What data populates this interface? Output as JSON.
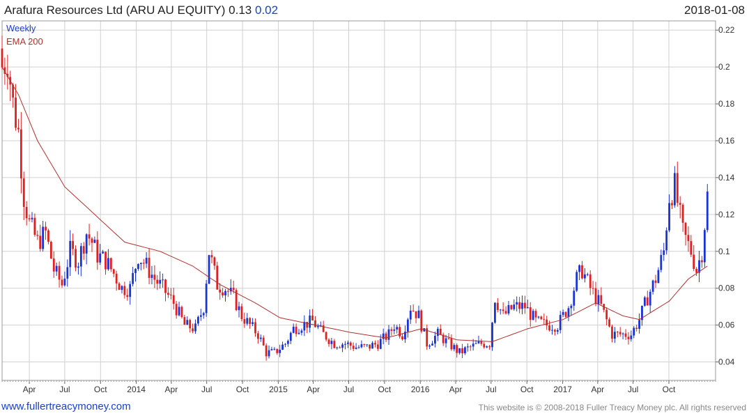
{
  "header": {
    "title": "Arafura Resources Ltd (ARU AU EQUITY) 0.13",
    "change": "0.02",
    "date": "2018-01-08"
  },
  "footer": {
    "site": "www.fullertreacymoney.com",
    "copyright": "This website is © 2008-2018 Fuller Treacy Money plc. All rights reserved"
  },
  "colors": {
    "up": "#1a33d6",
    "down": "#e02020",
    "ema": "#b03030",
    "grid": "#d0d0d0"
  },
  "chart_data": {
    "type": "candlestick",
    "legend": [
      "Weekly",
      "EMA 200"
    ],
    "ylim": [
      0.03,
      0.225
    ],
    "yticks": [
      0.04,
      0.06,
      0.08,
      0.1,
      0.12,
      0.14,
      0.16,
      0.18,
      0.2,
      0.22
    ],
    "ytick_labels": [
      "0.04",
      "0.06",
      "0.08",
      "0.1",
      "0.12",
      "0.14",
      "0.16",
      "0.18",
      "0.2",
      "0.22"
    ],
    "xlim": [
      "2013-01-21",
      "2018-01-29"
    ],
    "xticks": [
      {
        "date": "2013-04-01",
        "label": "Apr"
      },
      {
        "date": "2013-07-01",
        "label": "Jul"
      },
      {
        "date": "2013-10-01",
        "label": "Oct"
      },
      {
        "date": "2014-01-01",
        "label": "2014"
      },
      {
        "date": "2014-04-01",
        "label": "Apr"
      },
      {
        "date": "2014-07-01",
        "label": "Jul"
      },
      {
        "date": "2014-10-01",
        "label": "Oct"
      },
      {
        "date": "2015-01-01",
        "label": "2015"
      },
      {
        "date": "2015-04-01",
        "label": "Apr"
      },
      {
        "date": "2015-07-01",
        "label": "Jul"
      },
      {
        "date": "2015-10-01",
        "label": "Oct"
      },
      {
        "date": "2016-01-01",
        "label": "2016"
      },
      {
        "date": "2016-04-01",
        "label": "Apr"
      },
      {
        "date": "2016-07-01",
        "label": "Jul"
      },
      {
        "date": "2016-10-01",
        "label": "Oct"
      },
      {
        "date": "2017-01-01",
        "label": "2017"
      },
      {
        "date": "2017-04-01",
        "label": "Apr"
      },
      {
        "date": "2017-07-01",
        "label": "Jul"
      },
      {
        "date": "2017-10-01",
        "label": "Oct"
      }
    ],
    "close_anchors": [
      [
        "2013-01-21",
        0.2
      ],
      [
        "2013-02-04",
        0.205
      ],
      [
        "2013-02-18",
        0.18
      ],
      [
        "2013-03-04",
        0.165
      ],
      [
        "2013-03-18",
        0.13
      ],
      [
        "2013-04-01",
        0.115
      ],
      [
        "2013-04-22",
        0.105
      ],
      [
        "2013-05-13",
        0.11
      ],
      [
        "2013-06-03",
        0.09
      ],
      [
        "2013-06-24",
        0.082
      ],
      [
        "2013-07-15",
        0.1
      ],
      [
        "2013-08-05",
        0.095
      ],
      [
        "2013-08-26",
        0.11
      ],
      [
        "2013-09-09",
        0.105
      ],
      [
        "2013-09-23",
        0.098
      ],
      [
        "2013-10-14",
        0.095
      ],
      [
        "2013-11-04",
        0.088
      ],
      [
        "2013-11-25",
        0.08
      ],
      [
        "2013-12-16",
        0.08
      ],
      [
        "2014-01-06",
        0.098
      ],
      [
        "2014-01-27",
        0.092
      ],
      [
        "2014-02-17",
        0.085
      ],
      [
        "2014-03-10",
        0.08
      ],
      [
        "2014-04-07",
        0.072
      ],
      [
        "2014-05-05",
        0.06
      ],
      [
        "2014-06-02",
        0.058
      ],
      [
        "2014-06-23",
        0.07
      ],
      [
        "2014-07-07",
        0.1
      ],
      [
        "2014-07-28",
        0.082
      ],
      [
        "2014-08-18",
        0.08
      ],
      [
        "2014-09-08",
        0.075
      ],
      [
        "2014-09-29",
        0.065
      ],
      [
        "2014-10-20",
        0.06
      ],
      [
        "2014-11-10",
        0.055
      ],
      [
        "2014-12-01",
        0.045
      ],
      [
        "2014-12-22",
        0.045
      ],
      [
        "2015-01-19",
        0.05
      ],
      [
        "2015-02-09",
        0.058
      ],
      [
        "2015-03-02",
        0.06
      ],
      [
        "2015-03-30",
        0.062
      ],
      [
        "2015-04-27",
        0.055
      ],
      [
        "2015-05-25",
        0.05
      ],
      [
        "2015-06-22",
        0.05
      ],
      [
        "2015-07-20",
        0.048
      ],
      [
        "2015-08-17",
        0.048
      ],
      [
        "2015-09-14",
        0.05
      ],
      [
        "2015-10-12",
        0.055
      ],
      [
        "2015-10-26",
        0.06
      ],
      [
        "2015-11-16",
        0.055
      ],
      [
        "2015-12-07",
        0.07
      ],
      [
        "2015-12-28",
        0.065
      ],
      [
        "2016-01-18",
        0.05
      ],
      [
        "2016-02-15",
        0.055
      ],
      [
        "2016-03-14",
        0.05
      ],
      [
        "2016-04-11",
        0.045
      ],
      [
        "2016-05-09",
        0.048
      ],
      [
        "2016-06-06",
        0.05
      ],
      [
        "2016-06-27",
        0.05
      ],
      [
        "2016-07-11",
        0.075
      ],
      [
        "2016-08-01",
        0.065
      ],
      [
        "2016-08-29",
        0.07
      ],
      [
        "2016-09-26",
        0.07
      ],
      [
        "2016-10-24",
        0.062
      ],
      [
        "2016-11-21",
        0.06
      ],
      [
        "2016-12-19",
        0.06
      ],
      [
        "2017-01-16",
        0.07
      ],
      [
        "2017-02-06",
        0.085
      ],
      [
        "2017-02-20",
        0.09
      ],
      [
        "2017-03-13",
        0.08
      ],
      [
        "2017-04-10",
        0.07
      ],
      [
        "2017-05-08",
        0.055
      ],
      [
        "2017-06-05",
        0.055
      ],
      [
        "2017-06-26",
        0.055
      ],
      [
        "2017-07-17",
        0.063
      ],
      [
        "2017-08-07",
        0.075
      ],
      [
        "2017-08-28",
        0.085
      ],
      [
        "2017-09-18",
        0.1
      ],
      [
        "2017-10-02",
        0.13
      ],
      [
        "2017-10-16",
        0.135
      ],
      [
        "2017-11-06",
        0.11
      ],
      [
        "2017-11-27",
        0.1
      ],
      [
        "2017-12-11",
        0.09
      ],
      [
        "2017-12-25",
        0.1
      ],
      [
        "2018-01-08",
        0.13
      ]
    ],
    "ema_anchors": [
      [
        "2013-01-21",
        0.2
      ],
      [
        "2013-03-04",
        0.185
      ],
      [
        "2013-04-22",
        0.16
      ],
      [
        "2013-07-01",
        0.135
      ],
      [
        "2013-09-16",
        0.12
      ],
      [
        "2013-12-02",
        0.105
      ],
      [
        "2014-03-03",
        0.1
      ],
      [
        "2014-05-26",
        0.092
      ],
      [
        "2014-08-04",
        0.082
      ],
      [
        "2014-11-03",
        0.072
      ],
      [
        "2015-01-05",
        0.064
      ],
      [
        "2015-04-06",
        0.06
      ],
      [
        "2015-07-06",
        0.056
      ],
      [
        "2015-10-05",
        0.053
      ],
      [
        "2016-01-04",
        0.058
      ],
      [
        "2016-04-04",
        0.052
      ],
      [
        "2016-07-04",
        0.051
      ],
      [
        "2016-10-03",
        0.058
      ],
      [
        "2017-01-02",
        0.063
      ],
      [
        "2017-03-27",
        0.072
      ],
      [
        "2017-06-05",
        0.065
      ],
      [
        "2017-07-17",
        0.063
      ],
      [
        "2017-10-02",
        0.073
      ],
      [
        "2017-11-20",
        0.085
      ],
      [
        "2018-01-08",
        0.092
      ]
    ]
  }
}
